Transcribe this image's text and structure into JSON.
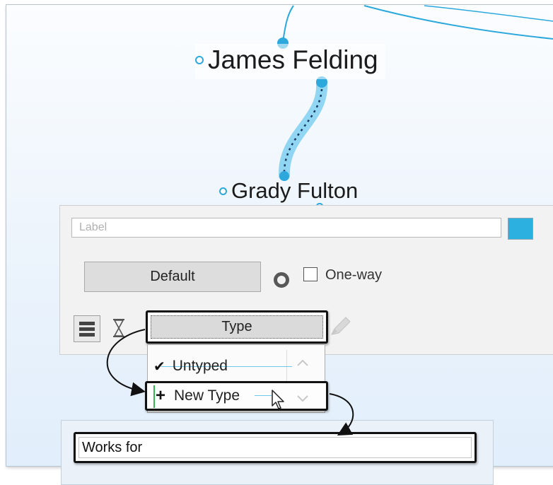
{
  "map": {
    "nodes": [
      {
        "label": "James Felding"
      },
      {
        "label": "Grady Fulton"
      }
    ],
    "link_color": "#2ca8dc"
  },
  "properties_panel": {
    "label_placeholder": "Label",
    "color_swatch": "#2cb0e0",
    "default_button": "Default",
    "one_way_label": "One-way",
    "one_way_checked": false,
    "type_button": "Type",
    "icons": [
      "ring-icon",
      "list-icon",
      "hourglass-icon",
      "pencil-icon"
    ]
  },
  "type_dropdown": {
    "items": [
      {
        "glyph": "✔",
        "label": "Untyped",
        "selected": true
      },
      {
        "glyph": "+",
        "label": "New Type",
        "selected": false
      }
    ]
  },
  "new_type_editor": {
    "value": "Works for"
  }
}
